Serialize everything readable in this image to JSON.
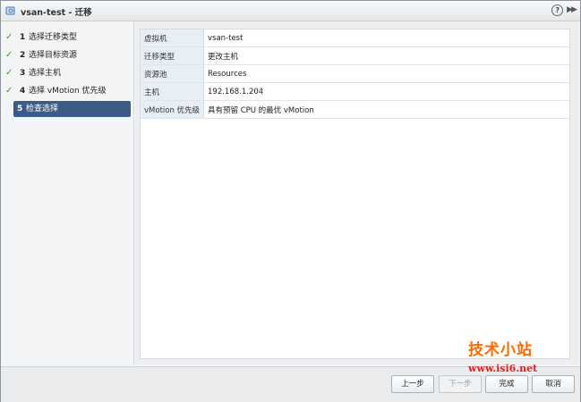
{
  "window": {
    "title": "vsan-test - 迁移",
    "help_label": "?",
    "expand_label": "▶▶"
  },
  "steps": [
    {
      "num": "1",
      "label": "选择迁移类型",
      "completed": true
    },
    {
      "num": "2",
      "label": "选择目标资源",
      "completed": true
    },
    {
      "num": "3",
      "label": "选择主机",
      "completed": true
    },
    {
      "num": "4",
      "label": "选择 vMotion 优先级",
      "completed": true
    },
    {
      "num": "5",
      "label": "检查选择",
      "completed": false,
      "active": true
    }
  ],
  "summary": [
    {
      "key": "虚拟机",
      "value": "vsan-test"
    },
    {
      "key": "迁移类型",
      "value": "更改主机"
    },
    {
      "key": "资源池",
      "value": "Resources"
    },
    {
      "key": "主机",
      "value": "192.168.1.204"
    },
    {
      "key": "vMotion 优先级",
      "value": "具有预留 CPU 的最优 vMotion"
    }
  ],
  "buttons": {
    "back": "上一步",
    "next": "下一步",
    "finish": "完成",
    "cancel": "取消"
  },
  "watermark": {
    "cn": "技术小站",
    "url": "www.isi6.net"
  },
  "colors": {
    "active_step_bg": "#3c5b86",
    "check": "#3e9a2a",
    "key_cell_bg": "#e7eef6",
    "watermark_orange": "#ff6a00",
    "watermark_red": "#e02020"
  }
}
